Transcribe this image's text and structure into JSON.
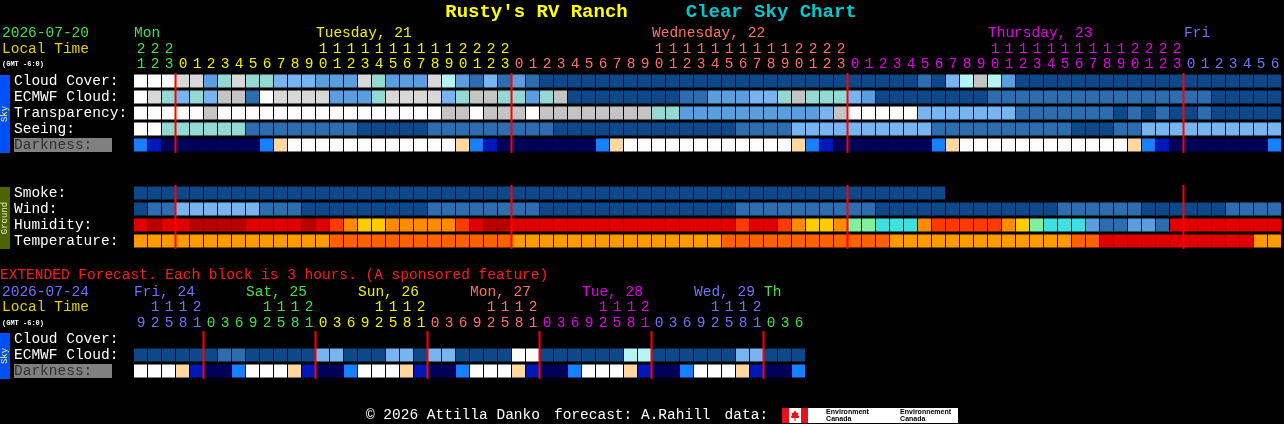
{
  "header": {
    "site_name": "Rusty's RV Ranch",
    "chart_title": "Clear Sky Chart"
  },
  "main": {
    "date": "2026-07-20",
    "local_time": "Local Time",
    "timezone": "(GMT -6:0)",
    "days": [
      {
        "label": "Mon",
        "color": "#44e044",
        "hours": [
          "21",
          "22",
          "23"
        ]
      },
      {
        "label": "Tuesday, 21",
        "color": "#f0f000",
        "hours": [
          "0",
          "1",
          "2",
          "3",
          "4",
          "5",
          "6",
          "7",
          "8",
          "9",
          "10",
          "11",
          "12",
          "13",
          "14",
          "15",
          "16",
          "17",
          "18",
          "19",
          "20",
          "21",
          "22",
          "23"
        ]
      },
      {
        "label": "Wednesday, 22",
        "color": "#ff7060",
        "hours": [
          "0",
          "1",
          "2",
          "3",
          "4",
          "5",
          "6",
          "7",
          "8",
          "9",
          "10",
          "11",
          "12",
          "13",
          "14",
          "15",
          "16",
          "17",
          "18",
          "19",
          "20",
          "21",
          "22",
          "23"
        ]
      },
      {
        "label": "Thursday, 23",
        "color": "#e000e0",
        "hours": [
          "0",
          "1",
          "2",
          "3",
          "4",
          "5",
          "6",
          "7",
          "8",
          "9",
          "10",
          "11",
          "12",
          "13",
          "14",
          "15",
          "16",
          "17",
          "18",
          "19",
          "20",
          "21",
          "22",
          "23"
        ]
      },
      {
        "label": "Fri",
        "color": "#7070ff",
        "hours": [
          "0",
          "1",
          "2",
          "3",
          "4",
          "5",
          "6"
        ]
      }
    ],
    "sky_label": "Sky",
    "sky_rows": [
      {
        "label": "Cloud Cover:",
        "kind": "cloud"
      },
      {
        "label": "ECMWF Cloud:",
        "kind": "ecmwf"
      },
      {
        "label": "Transparency:",
        "kind": "transparency"
      },
      {
        "label": "Seeing:",
        "kind": "seeing"
      },
      {
        "label": "Darkness:",
        "kind": "darkness"
      }
    ],
    "ground_label": "Ground",
    "ground_rows": [
      {
        "label": "Smoke:",
        "kind": "smoke"
      },
      {
        "label": "Wind:",
        "kind": "wind"
      },
      {
        "label": "Humidity:",
        "kind": "humidity"
      },
      {
        "label": "Temperature:",
        "kind": "temperature"
      }
    ]
  },
  "extended": {
    "notice": "EXTENDED Forecast. Each block is 3 hours. (A sponsored feature)",
    "date": "2026-07-24",
    "local_time": "Local Time",
    "timezone": "(GMT -6:0)",
    "days": [
      {
        "label": "Fri, 24",
        "color": "#7070ff",
        "hours": [
          "9",
          "12",
          "15",
          "18",
          "21"
        ]
      },
      {
        "label": "Sat, 25",
        "color": "#44e044",
        "hours": [
          "0",
          "3",
          "6",
          "9",
          "12",
          "15",
          "18",
          "21"
        ]
      },
      {
        "label": "Sun, 26",
        "color": "#f0f000",
        "hours": [
          "0",
          "3",
          "6",
          "9",
          "12",
          "15",
          "18",
          "21"
        ]
      },
      {
        "label": "Mon, 27",
        "color": "#ff7060",
        "hours": [
          "0",
          "3",
          "6",
          "9",
          "12",
          "15",
          "18",
          "21"
        ]
      },
      {
        "label": "Tue, 28",
        "color": "#e000e0",
        "hours": [
          "0",
          "3",
          "6",
          "9",
          "12",
          "15",
          "18",
          "21"
        ]
      },
      {
        "label": "Wed, 29",
        "color": "#7070ff",
        "hours": [
          "0",
          "3",
          "6",
          "9",
          "12",
          "15",
          "18",
          "21"
        ]
      },
      {
        "label": "Th",
        "color": "#44e044",
        "hours": [
          "0",
          "3",
          "6"
        ]
      }
    ],
    "sky_label": "Sky",
    "sky_rows": [
      {
        "label": "Cloud Cover:",
        "kind": "cloud"
      },
      {
        "label": "ECMWF Cloud:",
        "kind": "ecmwf"
      },
      {
        "label": "Darkness:",
        "kind": "darkness"
      }
    ]
  },
  "footer": {
    "copyright": "© 2026 Attilla Danko",
    "forecast": "forecast: A.Rahill",
    "data": "data:",
    "sponsor_names": [
      "Environment Canada",
      "Environnement Canada"
    ]
  }
}
